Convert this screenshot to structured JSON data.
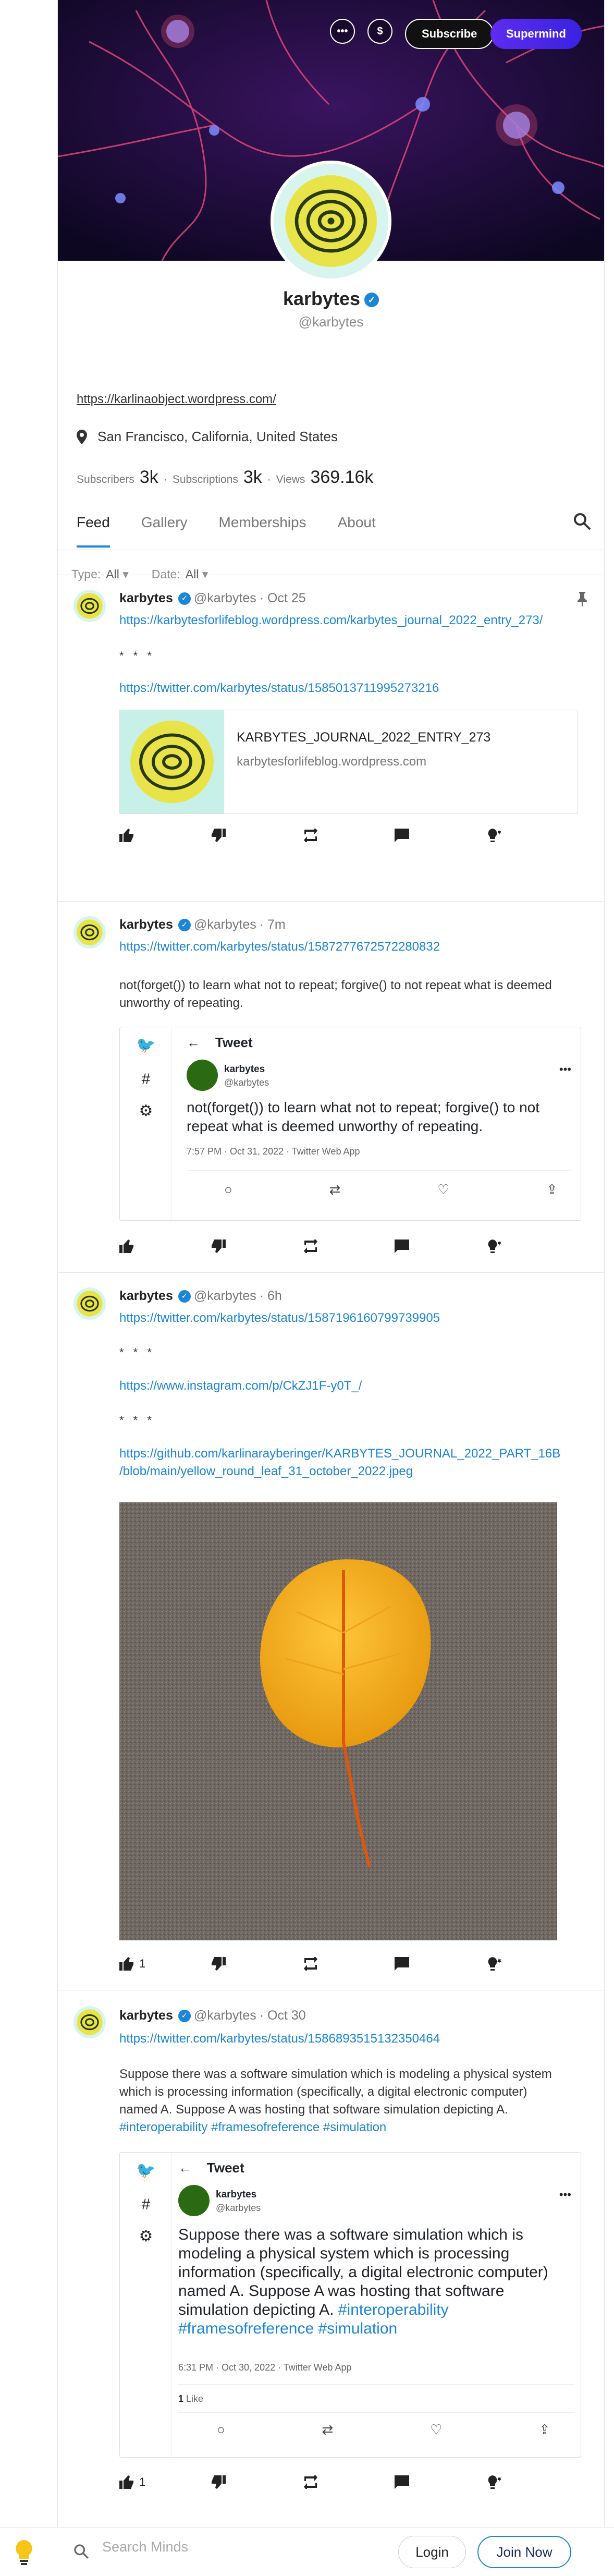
{
  "header": {
    "more_label": "•••",
    "tip_label": "$",
    "subscribe_label": "Subscribe",
    "supermind_label": "Supermind"
  },
  "profile": {
    "name": "karbytes",
    "handle": "@karbytes",
    "link": "https://karlinaobject.wordpress.com/",
    "location": "San Francisco, California, United States",
    "subscribers_label": "Subscribers",
    "subscribers": "3k",
    "subscriptions_label": "Subscriptions",
    "subscriptions": "3k",
    "views_label": "Views",
    "views": "369.16k"
  },
  "tabs": [
    "Feed",
    "Gallery",
    "Memberships",
    "About"
  ],
  "filters": {
    "type_label": "Type:",
    "type_value": "All",
    "date_label": "Date:",
    "date_value": "All"
  },
  "posts": [
    {
      "author": "karbytes",
      "handle": "@karbytes",
      "time": "· Oct 25",
      "link1": "https://karbytesforlifeblog.wordpress.com/karbytes_journal_2022_entry_273/",
      "stars": "* * *",
      "link2": "https://twitter.com/karbytes/status/1585013711995273216",
      "preview_title": "KARBYTES_JOURNAL_2022_ENTRY_273",
      "preview_domain": "karbytesforlifeblog.wordpress.com"
    },
    {
      "author": "karbytes",
      "handle": "@karbytes",
      "time": "· 7m",
      "link1": "https://twitter.com/karbytes/status/1587277672572280832",
      "text": "not(forget()) to learn what not to repeat; forgive() to not repeat what is deemed unworthy of repeating.",
      "tweet": {
        "title": "Tweet",
        "name": "karbytes",
        "handle": "@karbytes",
        "body": "not(forget()) to learn what not to repeat; forgive() to not repeat what is deemed unworthy of repeating.",
        "meta": "7:57 PM · Oct 31, 2022 · Twitter Web App"
      }
    },
    {
      "author": "karbytes",
      "handle": "@karbytes",
      "time": "· 6h",
      "link1": "https://twitter.com/karbytes/status/1587196160799739905",
      "stars1": "* * *",
      "link2": "https://www.instagram.com/p/CkZJ1F-y0T_/",
      "stars2": "* * *",
      "link3a": "https://github.com/karlinarayberinger/KARBYTES_JOURNAL_2022_PART_16B",
      "link3b": "/blob/main/yellow_round_leaf_31_october_2022.jpeg",
      "likes": "1"
    },
    {
      "author": "karbytes",
      "handle": "@karbytes",
      "time": "· Oct 30",
      "link1": "https://twitter.com/karbytes/status/1586893515132350464",
      "text_l1": "Suppose there was a software simulation which is modeling a physical system",
      "text_l2": "which is processing information (specifically, a digital electronic computer)",
      "text_l3": "named A. Suppose A was hosting that software simulation depicting A.",
      "tags": "#interoperability #framesofreference #simulation",
      "tweet": {
        "title": "Tweet",
        "name": "karbytes",
        "handle": "@karbytes",
        "b1": "Suppose there was a software simulation which is",
        "b2": "modeling a physical system which is processing",
        "b3": "information (specifically, a digital electronic computer)",
        "b4": "named A. Suppose A was hosting that software",
        "b5": "simulation depicting A.",
        "tag1": "#interoperability",
        "tag2": "#framesofreference #simulation",
        "meta": "6:31 PM · Oct 30, 2022 · Twitter Web App",
        "likes": "1",
        "likes_label": "Like"
      },
      "likes": "1"
    }
  ],
  "footer": {
    "search_placeholder": "Search Minds",
    "login_label": "Login",
    "join_label": "Join Now"
  }
}
